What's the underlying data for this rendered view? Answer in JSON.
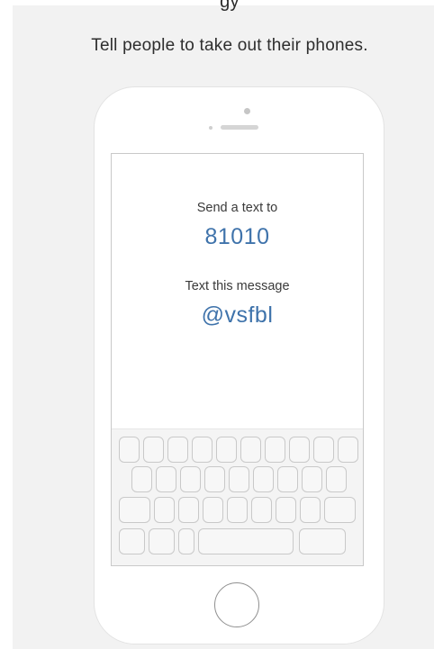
{
  "page": {
    "cut_text": "gy",
    "heading": "Tell people to take out their phones."
  },
  "phone_screen": {
    "send_label": "Send a text to",
    "number": "81010",
    "message_label": "Text this message",
    "keyword": "@vsfbl"
  },
  "colors": {
    "accent": "#3f73ab",
    "text": "#333333",
    "panel_background": "#f2f2f2"
  }
}
